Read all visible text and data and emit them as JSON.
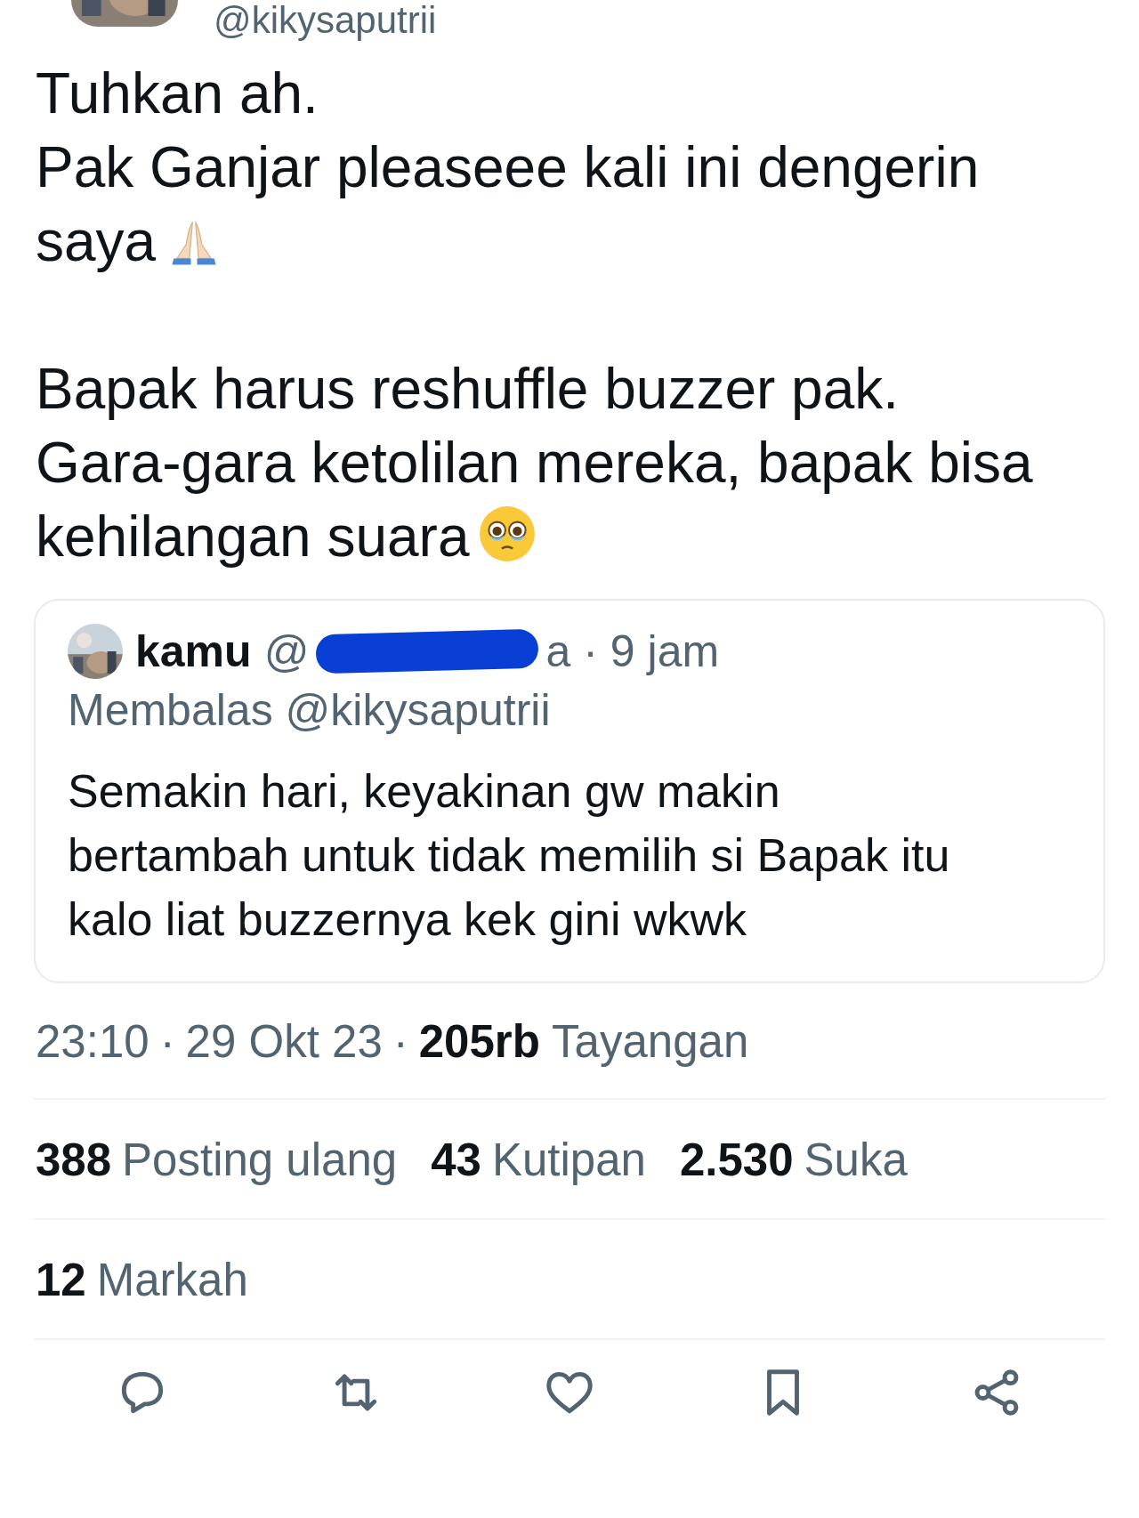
{
  "author": {
    "handle": "@kikysaputrii"
  },
  "tweet": {
    "paragraphs": [
      {
        "lines": [
          "Tuhkan ah.",
          "Pak Ganjar pleaseee kali ini dengerin",
          "saya"
        ],
        "end_icon": {
          "kind": "pray"
        }
      },
      {
        "lines": [
          "Bapak harus reshuffle buzzer pak.",
          "Gara-gara ketolilan mereka, bapak bisa",
          "kehilangan suara"
        ],
        "end_icon": {
          "kind": "teary"
        }
      }
    ]
  },
  "quote": {
    "name": "kamu",
    "handle_start": "@",
    "handle_end": "a",
    "separator": "·",
    "time": "9 jam",
    "replying_to": "Membalas @kikysaputrii",
    "lines": [
      "Semakin hari, keyakinan gw makin",
      "bertambah untuk tidak memilih si Bapak itu",
      "kalo liat buzzernya kek gini wkwk"
    ]
  },
  "meta": {
    "separator": "·",
    "time": "23:10",
    "date": "29 Okt 23",
    "views": "205rb",
    "views_label": "Tayangan"
  },
  "stats": [
    {
      "count": "388",
      "label": "Posting ulang"
    },
    {
      "count": "43",
      "label": "Kutipan"
    },
    {
      "count": "2.530",
      "label": "Suka"
    }
  ],
  "bookmarks": {
    "count": "12",
    "label": "Markah"
  },
  "actions": [
    {
      "kind": "reply"
    },
    {
      "kind": "repost"
    },
    {
      "kind": "like"
    },
    {
      "kind": "bookmark"
    },
    {
      "kind": "share"
    }
  ]
}
